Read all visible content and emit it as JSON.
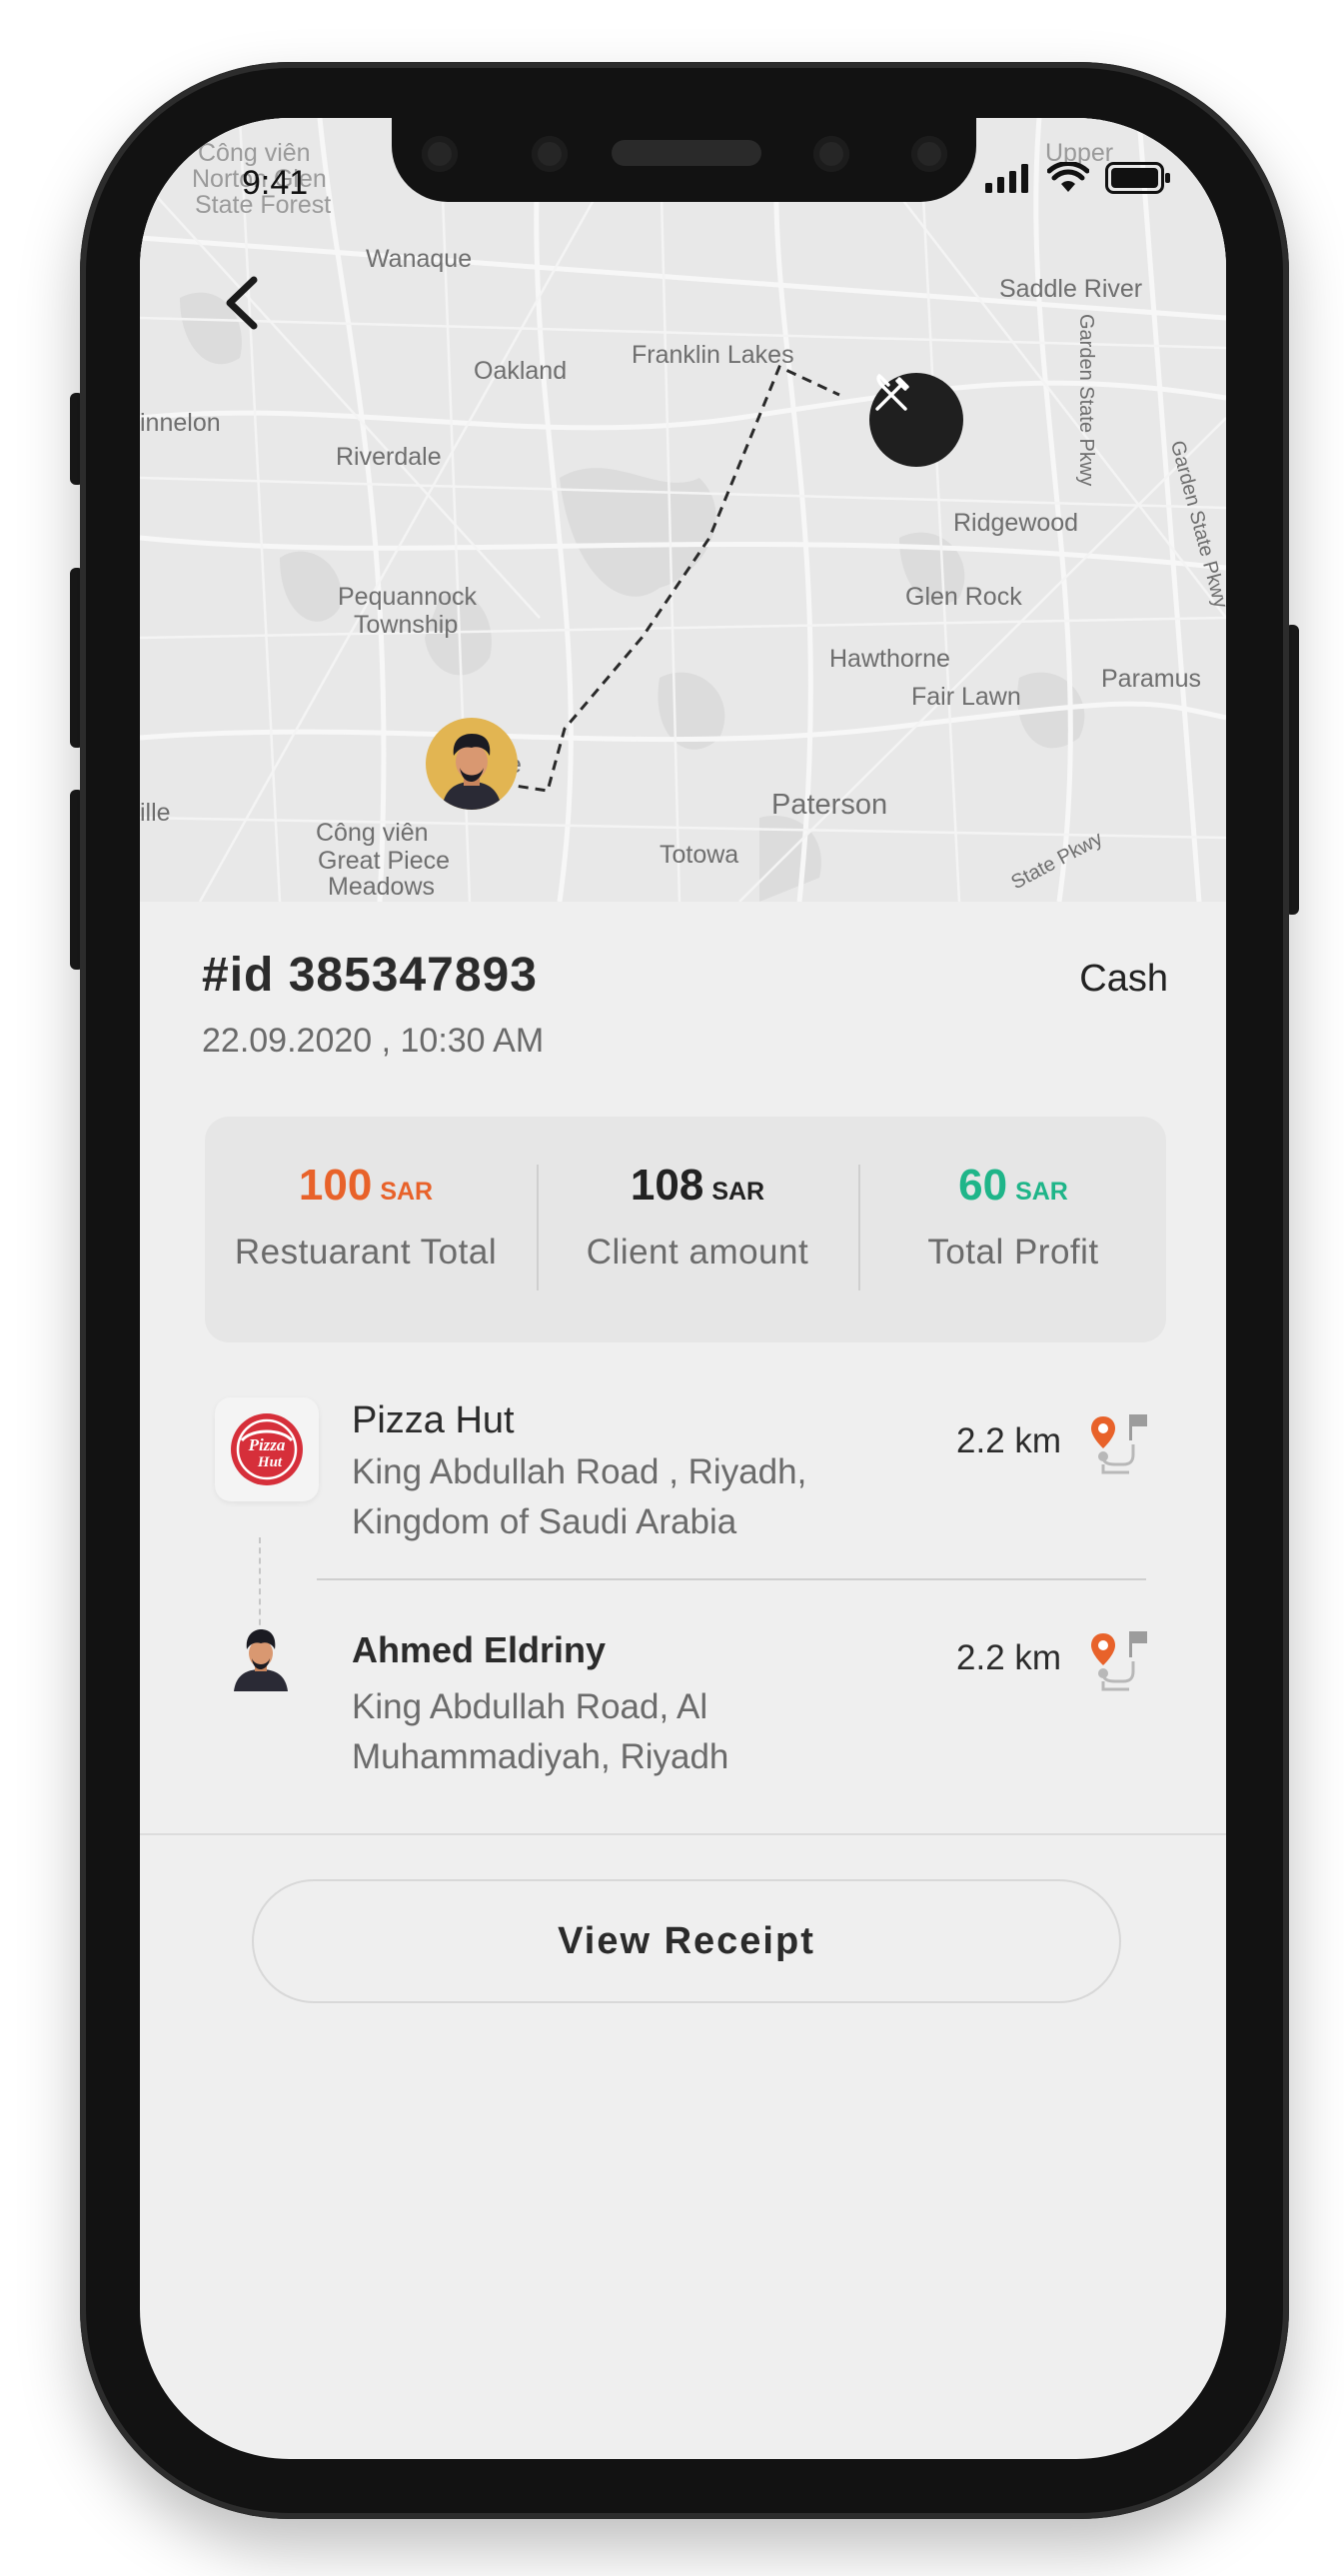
{
  "status_bar": {
    "time": "9:41"
  },
  "map": {
    "labels": [
      "Công viên",
      "Norton Glen",
      "State Forest",
      "Wanaque",
      "Saddle River",
      "Oakland",
      "Franklin Lakes",
      "innelon",
      "Riverdale",
      "Ridgewood",
      "Pequannock",
      "Township",
      "Glen Rock",
      "Hawthorne",
      "Fair Lawn",
      "Paramus",
      "Paterson",
      "ille",
      "Công viên",
      "Great Piece",
      "Meadows",
      "Totowa",
      "State Pkwy",
      "Garden State Pkwy",
      "Garden State Pkwy",
      "Upper",
      "e"
    ]
  },
  "order": {
    "id": "#id 385347893",
    "datetime": "22.09.2020 , 10:30 AM",
    "payment": "Cash"
  },
  "summary": [
    {
      "value": "100",
      "unit": "SAR",
      "label": "Restuarant Total",
      "color": "#e8622a"
    },
    {
      "value": "108",
      "unit": "SAR",
      "label": "Client amount",
      "color": "#222222"
    },
    {
      "value": "60",
      "unit": "SAR",
      "label": "Total Profit",
      "color": "#1fb589"
    }
  ],
  "stops": [
    {
      "name": "Pizza Hut",
      "address_line1": "King Abdullah Road , Riyadh,",
      "address_line2": "Kingdom of Saudi Arabia",
      "distance": "2.2 km",
      "logo_text": "Pizza Hut"
    },
    {
      "name": "Ahmed Eldriny",
      "address_line1": "King Abdullah Road, Al",
      "address_line2": "Muhammadiyah, Riyadh",
      "distance": "2.2 km"
    }
  ],
  "actions": {
    "view_receipt": "View Receipt"
  },
  "icons": {
    "back": "chevron-left-icon",
    "restaurant_pin": "fork-knife-icon",
    "route": "route-pin-flag-icon",
    "signal": "signal-icon",
    "wifi": "wifi-icon",
    "battery": "battery-icon"
  },
  "colors": {
    "accent_orange": "#e8622a",
    "accent_green": "#1fb589",
    "pin_yellow": "#e2b552",
    "pizza_red": "#d62f3a"
  }
}
